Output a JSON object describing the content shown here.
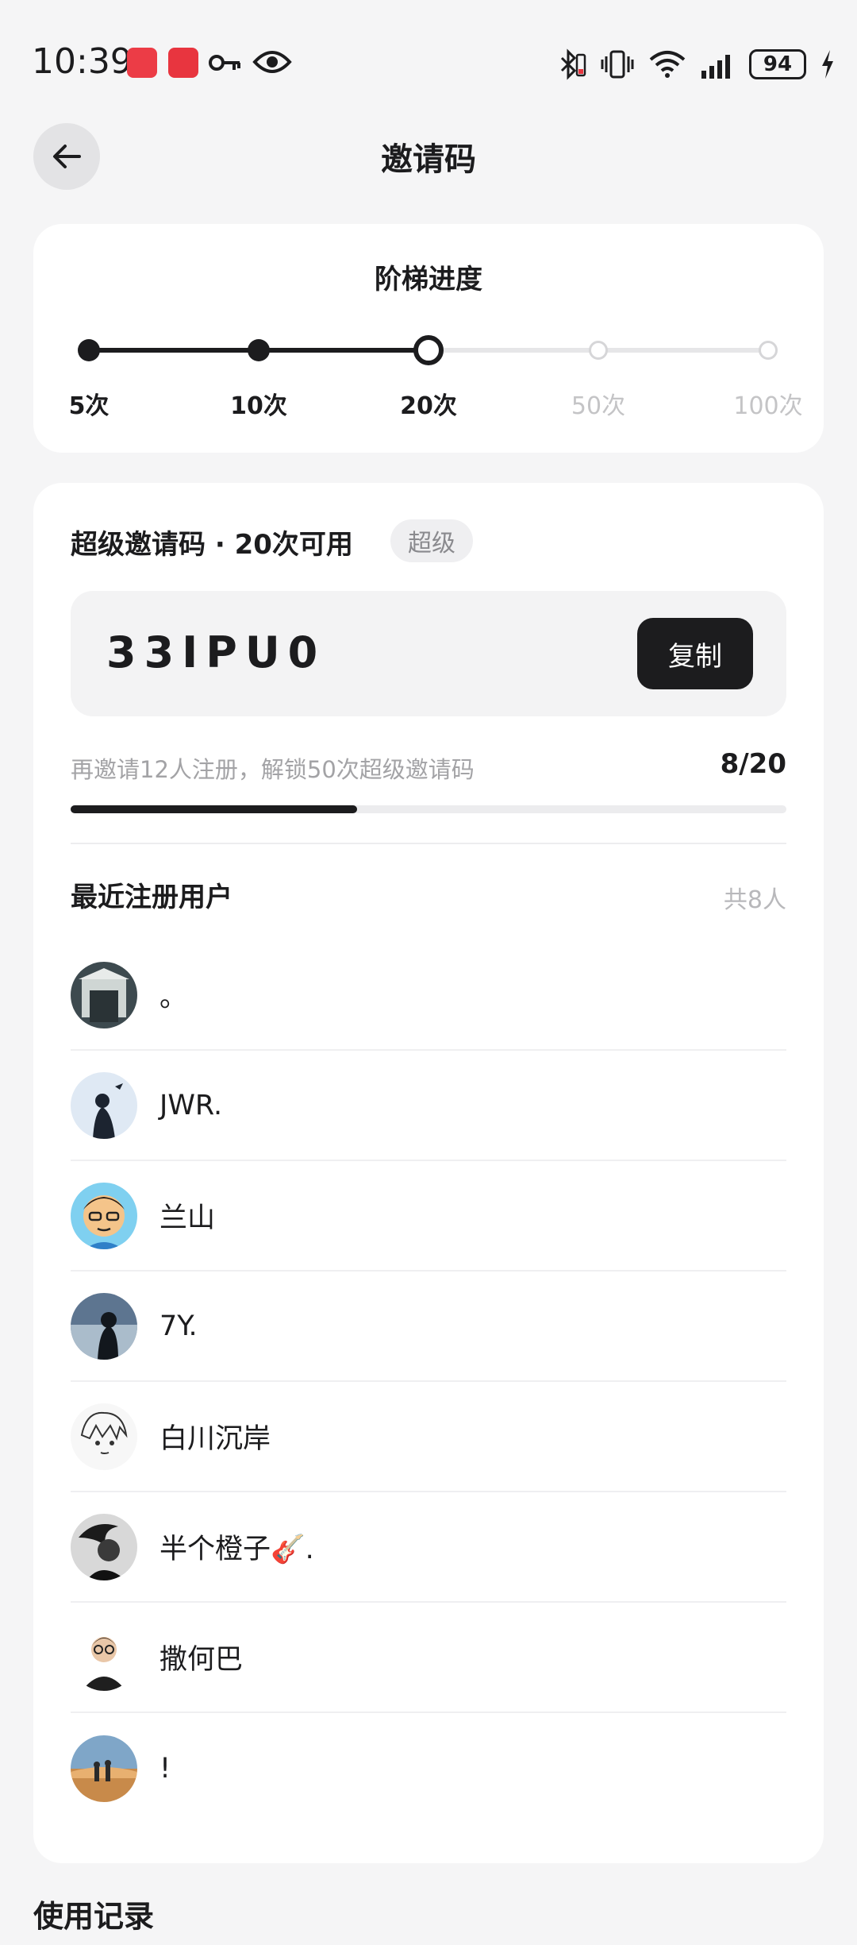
{
  "status_bar": {
    "time": "10:39",
    "battery": "94",
    "icons": [
      "huawei-appgallery-icon",
      "red-app-icon",
      "key-icon",
      "eye-icon",
      "bluetooth-icon",
      "vibrate-icon",
      "wifi-icon",
      "signal-icon",
      "charging-icon"
    ]
  },
  "header": {
    "title": "邀请码"
  },
  "ladder": {
    "title": "阶梯进度",
    "steps": [
      {
        "label": "5次",
        "state": "done"
      },
      {
        "label": "10次",
        "state": "done"
      },
      {
        "label": "20次",
        "state": "current"
      },
      {
        "label": "50次",
        "state": "pending"
      },
      {
        "label": "100次",
        "state": "pending"
      }
    ],
    "progress_fraction": 0.5
  },
  "invite": {
    "title": "超级邀请码 · 20次可用",
    "badge": "超级",
    "code": "33IPU0",
    "copy_label": "复制",
    "hint": "再邀请12人注册，解锁50次超级邀请码",
    "count_text": "8/20",
    "progress_fraction": 0.4
  },
  "recent": {
    "title": "最近注册用户",
    "count": "共8人",
    "users": [
      {
        "name": "。"
      },
      {
        "name": "JWR."
      },
      {
        "name": "兰山"
      },
      {
        "name": "7Y."
      },
      {
        "name": "白川沉岸"
      },
      {
        "name": "半个橙子🎸."
      },
      {
        "name": "撒何巴"
      },
      {
        "name": "!"
      }
    ]
  },
  "usage": {
    "title": "使用记录"
  },
  "colors": {
    "accent": "#1c1c1e",
    "background": "#f5f5f6",
    "card": "#ffffff",
    "muted": "#a3a3a6"
  }
}
